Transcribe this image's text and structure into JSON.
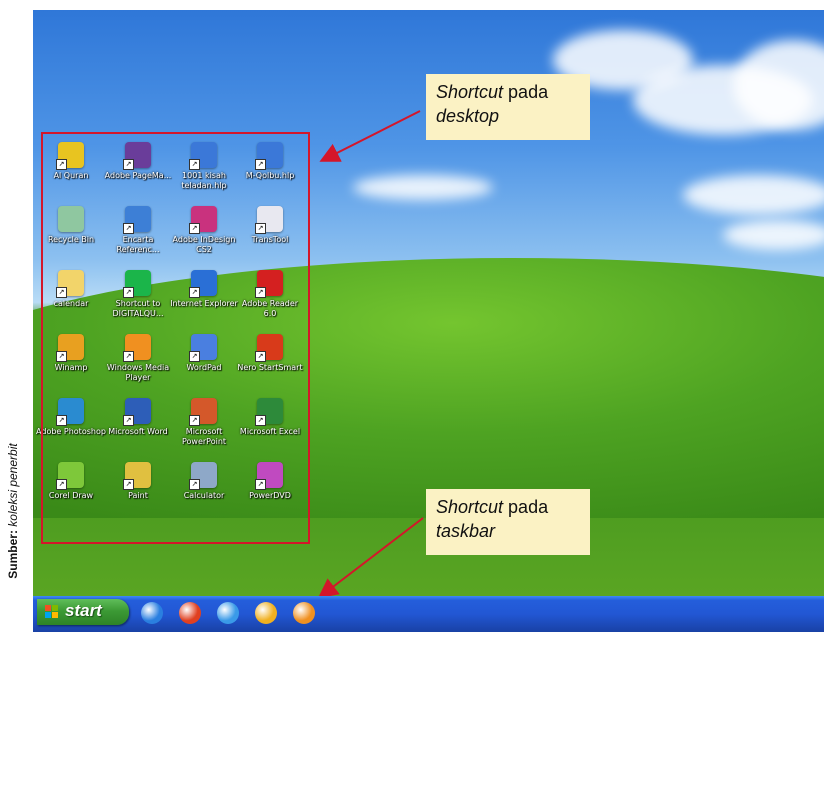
{
  "credit": {
    "label": "Sumber:",
    "text": "koleksi penerbit"
  },
  "callouts": {
    "desktop": {
      "em": "Shortcut",
      "rest": " pada",
      "line2": "desktop"
    },
    "taskbar": {
      "em": "Shortcut",
      "rest": " pada",
      "line2": "taskbar"
    }
  },
  "desktop_icons": [
    {
      "label": "Al Quran",
      "icon": "al-quran-icon",
      "color": "#e8c420"
    },
    {
      "label": "Adobe PageMa...",
      "icon": "pagemaker-icon",
      "color": "#6a3d9a"
    },
    {
      "label": "1001 kisah teladan.hlp",
      "icon": "help-icon",
      "color": "#3b78d8"
    },
    {
      "label": "M-Qolbu.hlp",
      "icon": "help-icon",
      "color": "#3b78d8"
    },
    {
      "label": "Recycle Bin",
      "icon": "recycle-bin-icon",
      "color": "#8fc7a0"
    },
    {
      "label": "Encarta Referenc...",
      "icon": "encarta-icon",
      "color": "#3d7fd6"
    },
    {
      "label": "Adobe InDesign CS2",
      "icon": "indesign-icon",
      "color": "#c9327e"
    },
    {
      "label": "TransTool",
      "icon": "transtool-icon",
      "color": "#e8e8f0"
    },
    {
      "label": "calendar",
      "icon": "folder-icon",
      "color": "#f2d46a"
    },
    {
      "label": "Shortcut to DIGITALQU...",
      "icon": "heart-icon",
      "color": "#1bb54a"
    },
    {
      "label": "Internet Explorer",
      "icon": "internet-explorer-icon",
      "color": "#2a6fd6"
    },
    {
      "label": "Adobe Reader 6.0",
      "icon": "adobe-reader-icon",
      "color": "#d42020"
    },
    {
      "label": "Winamp",
      "icon": "winamp-icon",
      "color": "#e8a020"
    },
    {
      "label": "Windows Media Player",
      "icon": "media-player-icon",
      "color": "#f09020"
    },
    {
      "label": "WordPad",
      "icon": "wordpad-icon",
      "color": "#4a7fe0"
    },
    {
      "label": "Nero StartSmart",
      "icon": "nero-icon",
      "color": "#d83a1a"
    },
    {
      "label": "Adobe Photoshop",
      "icon": "photoshop-icon",
      "color": "#2a8bd0"
    },
    {
      "label": "Microsoft Word",
      "icon": "word-icon",
      "color": "#2d5eb8"
    },
    {
      "label": "Microsoft PowerPoint",
      "icon": "powerpoint-icon",
      "color": "#d4582a"
    },
    {
      "label": "Microsoft Excel",
      "icon": "excel-icon",
      "color": "#2d8a3a"
    },
    {
      "label": "Corel Draw",
      "icon": "corel-draw-icon",
      "color": "#7ec83a"
    },
    {
      "label": "Paint",
      "icon": "paint-icon",
      "color": "#e0c040"
    },
    {
      "label": "Calculator",
      "icon": "calculator-icon",
      "color": "#8ea8c8"
    },
    {
      "label": "PowerDVD",
      "icon": "powerdvd-icon",
      "color": "#c04ac0"
    }
  ],
  "taskbar": {
    "start_label": "start",
    "quick_launch": [
      {
        "icon": "internet-explorer-icon",
        "color": "#2a7fe0"
      },
      {
        "icon": "nero-icon",
        "color": "#e04020"
      },
      {
        "icon": "outlook-express-icon",
        "color": "#3a9ae8"
      },
      {
        "icon": "winamp-icon",
        "color": "#f0b020"
      },
      {
        "icon": "media-player-icon",
        "color": "#f09020"
      }
    ]
  },
  "colors": {
    "highlight": "#d4162a",
    "callout_bg": "#fbf2c4",
    "taskbar": "#245edb",
    "start_button": "#3c9a35"
  }
}
